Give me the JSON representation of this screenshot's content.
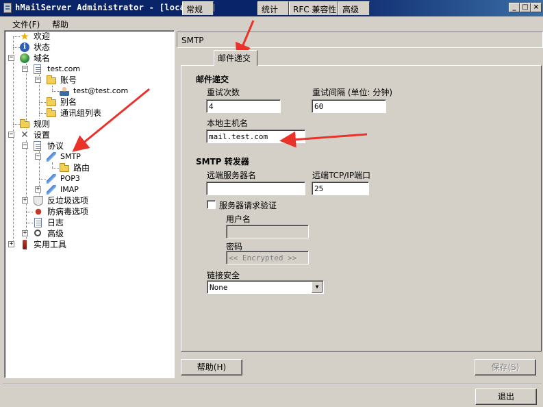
{
  "window": {
    "title": "hMailServer Administrator - [localhost]",
    "controls": {
      "minimize": "_",
      "maximize": "□",
      "close": "×"
    }
  },
  "menu": {
    "file": "文件(F)",
    "help": "帮助"
  },
  "tree": {
    "welcome": "欢迎",
    "status": "状态",
    "domains": "域名",
    "domain": "test.com",
    "accounts": "账号",
    "account": "test@test.com",
    "aliases": "别名",
    "distribution_lists": "通讯组列表",
    "rules": "规则",
    "settings": "设置",
    "protocols": "协议",
    "smtp": "SMTP",
    "routes": "路由",
    "pop3": "POP3",
    "imap": "IMAP",
    "antispam": "反垃圾选项",
    "antivirus": "防病毒选项",
    "logging": "日志",
    "advanced": "高级",
    "utilities": "实用工具",
    "expander_plus": "+",
    "expander_minus": "−"
  },
  "panel": {
    "header": "SMTP",
    "tabs": [
      "常规",
      "邮件递交",
      "统计",
      "RFC 兼容性",
      "高级"
    ],
    "active_tab": "邮件递交"
  },
  "delivery": {
    "section_title": "邮件递交",
    "retries_label": "重试次数",
    "retries_value": "4",
    "interval_label": "重试间隔 (单位: 分钟)",
    "interval_value": "60",
    "host_label": "本地主机名",
    "host_value": "mail.test.com"
  },
  "relay": {
    "section_title": "SMTP 转发器",
    "server_label": "远端服务器名",
    "server_value": "",
    "port_label": "远端TCP/IP端口",
    "port_value": "25",
    "auth_label": "服务器请求验证",
    "auth_checked": false,
    "username_label": "用户名",
    "username_value": "",
    "password_label": "密码",
    "password_value": "<< Encrypted >>",
    "security_label": "链接安全",
    "security_value": "None"
  },
  "buttons": {
    "help": "帮助(H)",
    "save": "保存(S)",
    "exit": "退出"
  },
  "colors": {
    "titlebar": "#0a246a",
    "face": "#d4d0c8",
    "annotation": "#e8322a"
  }
}
